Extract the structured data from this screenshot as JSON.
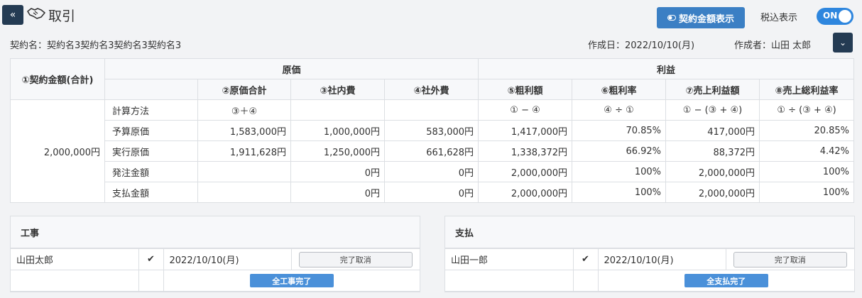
{
  "header": {
    "back_icon": "«",
    "title": "取引",
    "contract_btn_label": "契約金額表示",
    "tax_label": "税込表示",
    "toggle_label": "ON"
  },
  "meta": {
    "contract_name": "契約名：契約名3契約名3契約名3契約名3",
    "created_date": "作成日：2022/10/10(月)",
    "author": "作成者：山田 太郎"
  },
  "table": {
    "amount_header": "①契約金額(合計)",
    "group_cost": "原価",
    "group_profit": "利益",
    "columns": [
      "②原価合計",
      "③社内費",
      "④社外費",
      "⑤粗利額",
      "⑥粗利率",
      "⑦売上利益額",
      "⑧売上総利益率"
    ],
    "contract_amount": "2,000,000円",
    "rows": [
      {
        "label": "計算方法",
        "cells": [
          "③＋④",
          "",
          "",
          "① − ④",
          "④ ÷ ①",
          "① − (③ + ④)",
          "① ÷ (③ + ④)"
        ]
      },
      {
        "label": "予算原価",
        "cells": [
          "1,583,000円",
          "1,000,000円",
          "583,000円",
          "1,417,000円",
          "70.85%",
          "417,000円",
          "20.85%"
        ]
      },
      {
        "label": "実行原価",
        "cells": [
          "1,911,628円",
          "1,250,000円",
          "661,628円",
          "1,338,372円",
          "66.92%",
          "88,372円",
          "4.42%"
        ]
      },
      {
        "label": "発注金額",
        "cells": [
          "",
          "0円",
          "0円",
          "2,000,000円",
          "100%",
          "2,000,000円",
          "100%"
        ]
      },
      {
        "label": "支払金額",
        "cells": [
          "",
          "0円",
          "0円",
          "2,000,000円",
          "100%",
          "2,000,000円",
          "100%"
        ]
      }
    ]
  },
  "construction": {
    "title": "工事",
    "person": "山田太郎",
    "date": "2022/10/10(月)",
    "cancel_label": "完了取消",
    "complete_label": "全工事完了"
  },
  "payment": {
    "title": "支払",
    "person": "山田一郎",
    "date": "2022/10/10(月)",
    "cancel_label": "完了取消",
    "complete_label": "全支払完了"
  }
}
